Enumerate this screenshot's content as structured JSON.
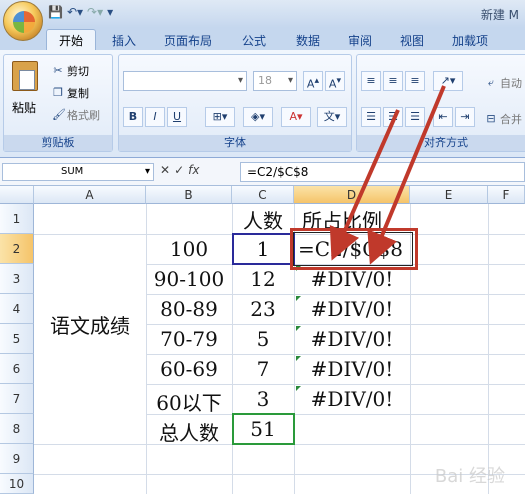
{
  "window": {
    "title": "新建 M"
  },
  "tabs": [
    "开始",
    "插入",
    "页面布局",
    "公式",
    "数据",
    "审阅",
    "视图",
    "加载项"
  ],
  "clipboard": {
    "paste": "粘贴",
    "cut": "剪切",
    "copy": "复制",
    "format_painter": "格式刷",
    "label": "剪贴板"
  },
  "font": {
    "name": "",
    "size": "18",
    "label": "字体",
    "bold": "B",
    "italic": "I",
    "underline": "U"
  },
  "alignment": {
    "label": "对齐方式",
    "wrap": "自动",
    "merge": "合并"
  },
  "formula_bar": {
    "name_box": "SUM",
    "formula": "=C2/$C$8"
  },
  "columns": [
    "A",
    "B",
    "C",
    "D",
    "E",
    "F"
  ],
  "rows": [
    "1",
    "2",
    "3",
    "4",
    "5",
    "6",
    "7",
    "8",
    "9",
    "10"
  ],
  "cells": {
    "A_merged": "语文成绩",
    "C1": "人数",
    "D1": "所占比例",
    "B2": "100",
    "C2": "1",
    "D2": "=C2/$C$8",
    "B3": "90-100",
    "C3": "12",
    "D3": "#DIV/0!",
    "B4": "80-89",
    "C4": "23",
    "D4": "#DIV/0!",
    "B5": "70-79",
    "C5": "5",
    "D5": "#DIV/0!",
    "B6": "60-69",
    "C6": "7",
    "D6": "#DIV/0!",
    "B7": "60以下",
    "C7": "3",
    "D7": "#DIV/0!",
    "B8": "总人数",
    "C8": "51"
  },
  "watermark": "Bai 经验",
  "colors": {
    "annotation_red": "#c0392b",
    "selection_blue": "#2a2a9a",
    "reference_green": "#2a9a3a"
  }
}
